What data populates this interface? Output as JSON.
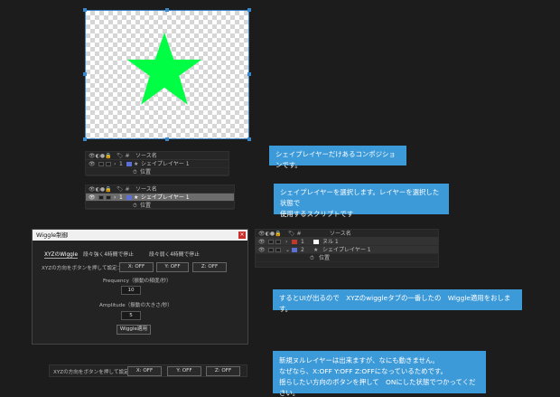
{
  "colors": {
    "accent": "#3d9ad9",
    "star": "#00ff44",
    "layer_blue": "#5b6fd6",
    "layer_red": "#c0392b"
  },
  "panel_top": {
    "header": "ソース名",
    "row_num": "1",
    "layer_name": "シェイプレイヤー 1",
    "sub": "位置"
  },
  "panel_mid": {
    "header": "ソース名",
    "row_num": "1",
    "layer_name": "シェイプレイヤー 1",
    "sub": "位置"
  },
  "panel_right": {
    "header": "ソース名",
    "rows": [
      {
        "num": "1",
        "name": "ヌル 1"
      },
      {
        "num": "2",
        "name": "シェイプレイヤー 1"
      }
    ],
    "sub": "位置"
  },
  "callouts": {
    "c1": "シェイプレイヤーだけあるコンポジションです。",
    "c2_line1": "シェイプレイヤーを選択します。レイヤーを選択した状態で",
    "c2_line2": "使用するスクリプトです",
    "c3": "するとUIが出るので　XYZのwiggleタブの一番したの　Wiggle適用をおします。",
    "c4_line1": "新規ヌルレイヤーは出来ますが、なにも動きません。",
    "c4_line2": "なぜなら、X:OFF Y:OFF  Z:OFFになっているためです。",
    "c4_line3": "揺らしたい方向のボタンを押して　ONにした状態でつかってください。"
  },
  "dialog": {
    "title": "Wiggle制御",
    "close": "×",
    "tabs": [
      "XYZのWiggle",
      "段々強く4時間で停止",
      "段々弱く4時間で停止"
    ],
    "direction_label": "XYZの方向をボタンを押して設定：",
    "x_btn": "X: OFF",
    "y_btn": "Y: OFF",
    "z_btn": "Z: OFF",
    "freq_label": "Frequency（振動の頻度/秒）",
    "freq_value": "10",
    "amp_label": "Amplitude（振動の大きさ/秒）",
    "amp_value": "5",
    "apply_btn": "Wiggle適用"
  },
  "strip": {
    "label": "XYZの方向をボタンを押して設定：",
    "x_btn": "X: OFF",
    "y_btn": "Y: OFF",
    "z_btn": "Z: OFF"
  }
}
